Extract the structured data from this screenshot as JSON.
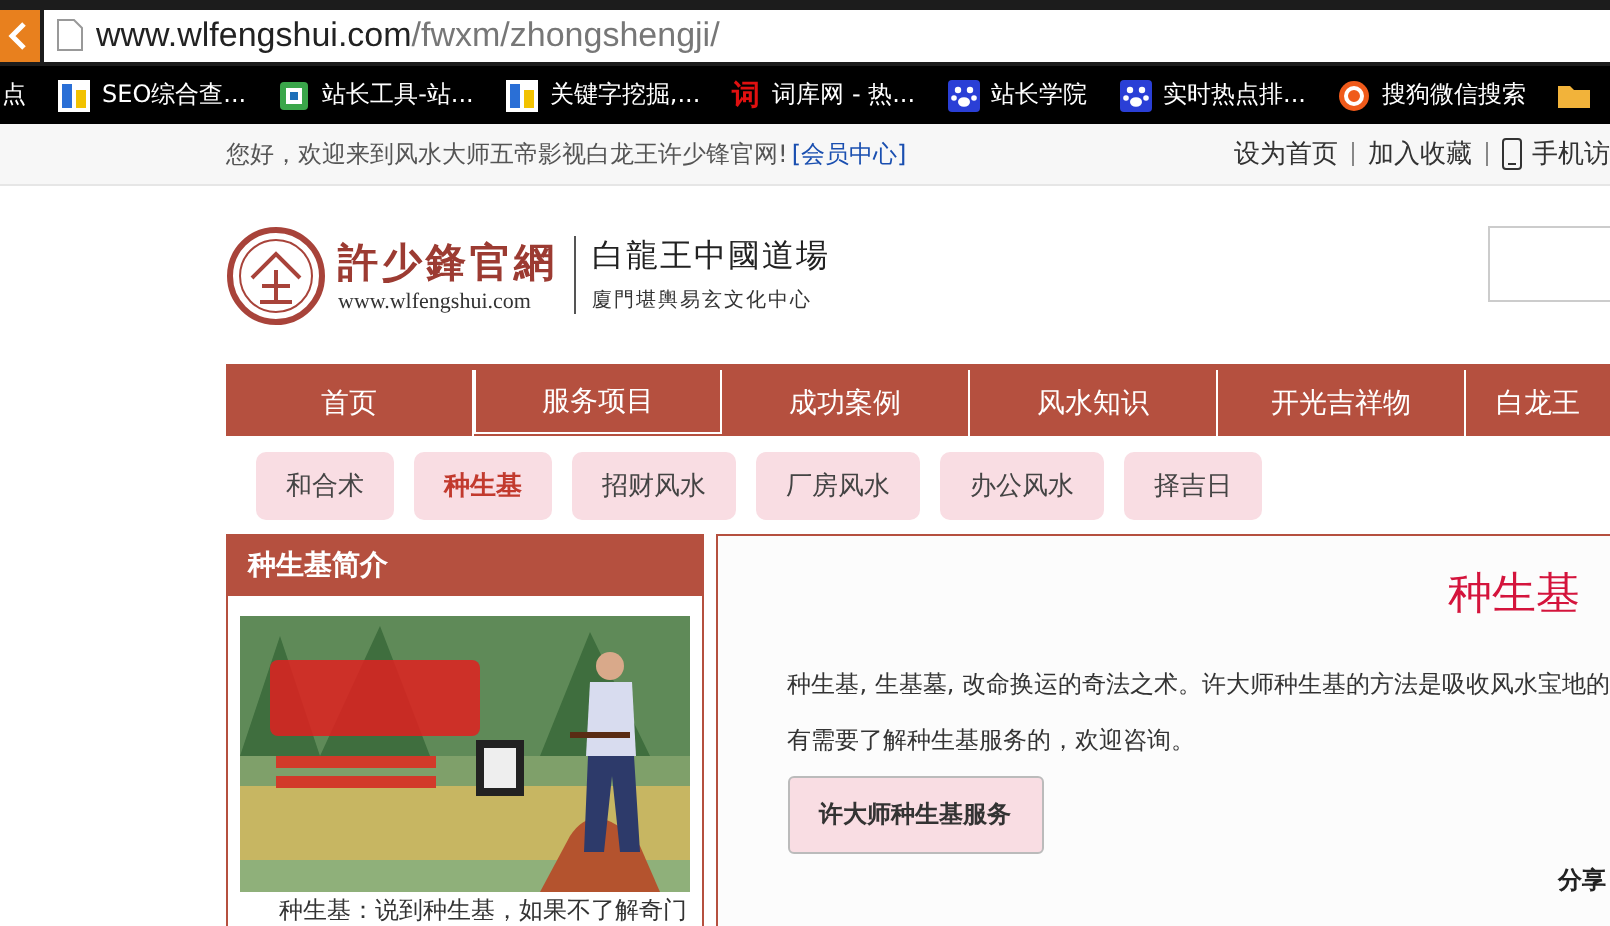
{
  "browser": {
    "url": {
      "host": "www.wlfengshui.com",
      "path": "/fwxm/zhongshengji/"
    }
  },
  "bookmarks": [
    {
      "kind": "none",
      "label": "点"
    },
    {
      "kind": "bars",
      "label": "SEO综合查..."
    },
    {
      "kind": "tool",
      "label": "站长工具-站..."
    },
    {
      "kind": "bars",
      "label": "关键字挖掘,..."
    },
    {
      "kind": "glyph",
      "glyph": "词",
      "label": "词库网 - 热..."
    },
    {
      "kind": "paw",
      "label": "站长学院"
    },
    {
      "kind": "paw",
      "label": "实时热点排..."
    },
    {
      "kind": "circle",
      "label": "搜狗微信搜索"
    },
    {
      "kind": "folder"
    }
  ],
  "top_bar": {
    "greeting": "您好，欢迎来到风水大师五帝影视白龙王许少锋官网!",
    "member_link": "[会员中心]",
    "links": [
      {
        "kind": "text",
        "label": "设为首页"
      },
      {
        "kind": "text",
        "label": "加入收藏"
      },
      {
        "kind": "phone",
        "label": "手机访"
      }
    ]
  },
  "logo": {
    "name": "許少鋒官網",
    "url": "www.wlfengshui.com",
    "title": "白龍王中國道場",
    "subtitle": "廈門堪輿易玄文化中心"
  },
  "nav": [
    {
      "label": "首页",
      "selected": false
    },
    {
      "label": "服务项目",
      "selected": true
    },
    {
      "label": "成功案例",
      "selected": false
    },
    {
      "label": "风水知识",
      "selected": false
    },
    {
      "label": "开光吉祥物",
      "selected": false
    },
    {
      "label": "白龙王",
      "selected": false
    }
  ],
  "subnav": [
    {
      "label": "和合术",
      "selected": false
    },
    {
      "label": "种生基",
      "selected": true
    },
    {
      "label": "招财风水",
      "selected": false
    },
    {
      "label": "厂房风水",
      "selected": false
    },
    {
      "label": "办公风水",
      "selected": false
    },
    {
      "label": "择吉日",
      "selected": false
    }
  ],
  "sidebar": {
    "title": "种生基简介",
    "caption": "种生基：说到种生基，如果不了解奇门"
  },
  "article": {
    "title": "种生基",
    "paragraphs": [
      "种生基, 生基墓, 改命换运的奇法之术。许大师种生基的方法是吸收风水宝地的",
      "有需要了解种生基服务的，欢迎咨询。"
    ],
    "button": "许大师种生基服务",
    "share": "分享"
  }
}
